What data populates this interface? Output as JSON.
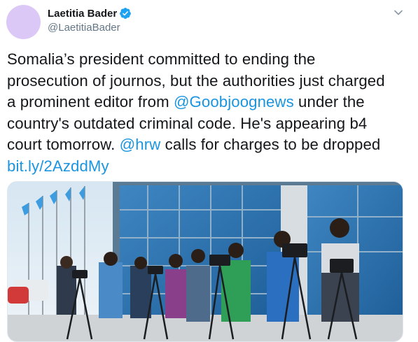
{
  "author": {
    "display_name": "Laetitia Bader",
    "handle": "@LaetitiaBader",
    "verified": true,
    "avatar_color": "#dcc8f7"
  },
  "tweet": {
    "lines": [
      [
        {
          "text": "Somalia’s president committed to ending the"
        }
      ],
      [
        {
          "text": "prosecution of journos, but the authorities just charged"
        }
      ],
      [
        {
          "text": "a prominent editor from "
        },
        {
          "text": "@Goobjoognews",
          "link": true
        },
        {
          "text": " under the"
        }
      ],
      [
        {
          "text": "country's outdated criminal code. He's appearing b4"
        }
      ],
      [
        {
          "text": "court tomorrow. "
        },
        {
          "text": "@hrw",
          "link": true
        },
        {
          "text": " calls for charges to be dropped"
        }
      ],
      [
        {
          "text": "bit.ly/2AzddMy",
          "link": true
        }
      ]
    ]
  },
  "colors": {
    "link": "#1b95e0",
    "verified": "#1da1f2",
    "muted": "#657786",
    "text": "#14171a"
  },
  "icons": {
    "verified": "verified-badge-icon",
    "menu": "chevron-down-icon"
  }
}
